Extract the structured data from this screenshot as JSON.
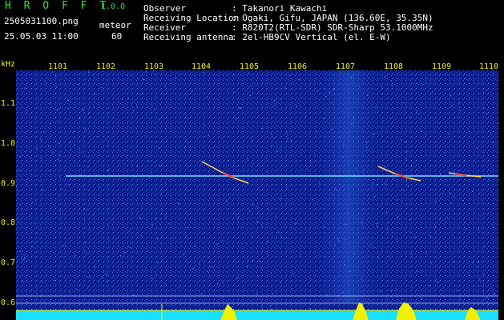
{
  "header": {
    "brand": "H R O F F T",
    "version": "1.0.0",
    "filename": "2505031100.png",
    "datetime": "25.05.03 11:00",
    "meteor_label": "meteor",
    "meteor_count": "60"
  },
  "info": [
    {
      "label": "Observer",
      "value": ": Takanori Kawachi"
    },
    {
      "label": "Receiving Location",
      "value": ": Ogaki, Gifu, JAPAN (136.60E, 35.35N)"
    },
    {
      "label": "Receiver",
      "value": ": R820T2(RTL-SDR) SDR-Sharp 53.1000MHz"
    },
    {
      "label": "Receiving antenna",
      "value": ": 2el-HB9CV Vertical (el. E-W)"
    }
  ],
  "axes": {
    "y_unit": "kHz",
    "y_ticks": [
      "1.1",
      "1.0",
      "0.9",
      "0.8",
      "0.7",
      "0.6"
    ],
    "x_ticks": [
      "1101",
      "1102",
      "1103",
      "1104",
      "1105",
      "1106",
      "1107",
      "1108",
      "1109",
      "1110"
    ]
  },
  "colors": {
    "background": "#000000",
    "waterfall_base": "#0a1a8c",
    "carrier_line": "#6fe0ff",
    "label_yellow": "#f0f000",
    "header_green": "#2fe02f"
  }
}
